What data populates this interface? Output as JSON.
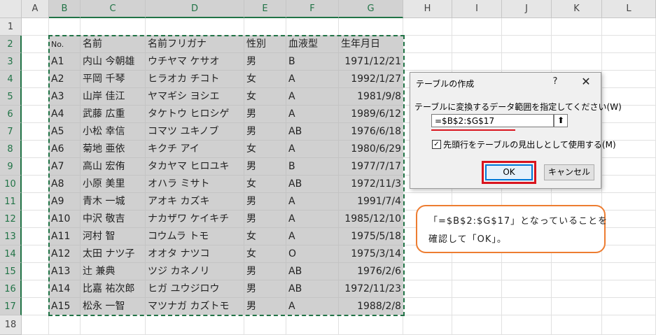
{
  "columns": [
    "A",
    "B",
    "C",
    "D",
    "E",
    "F",
    "G",
    "H",
    "I",
    "J",
    "K",
    "L"
  ],
  "rows": [
    "1",
    "2",
    "3",
    "4",
    "5",
    "6",
    "7",
    "8",
    "9",
    "10",
    "11",
    "12",
    "13",
    "14",
    "15",
    "16",
    "17",
    "18"
  ],
  "table": {
    "headers": [
      "No.",
      "名前",
      "名前フリガナ",
      "性別",
      "血液型",
      "生年月日"
    ],
    "data": [
      [
        "A1",
        "内山 今朝雄",
        "ウチヤマ ケサオ",
        "男",
        "B",
        "1971/12/21"
      ],
      [
        "A2",
        "平岡 千琴",
        "ヒラオカ チコト",
        "女",
        "A",
        "1992/1/27"
      ],
      [
        "A3",
        "山岸 佳江",
        "ヤマギシ ヨシエ",
        "女",
        "A",
        "1981/9/8"
      ],
      [
        "A4",
        "武藤 広重",
        "タケトウ ヒロシゲ",
        "男",
        "A",
        "1989/6/12"
      ],
      [
        "A5",
        "小松 幸信",
        "コマツ ユキノブ",
        "男",
        "AB",
        "1976/6/18"
      ],
      [
        "A6",
        "菊地 亜依",
        "キクチ アイ",
        "女",
        "A",
        "1980/6/29"
      ],
      [
        "A7",
        "高山 宏侑",
        "タカヤマ ヒロユキ",
        "男",
        "B",
        "1977/7/17"
      ],
      [
        "A8",
        "小原 美里",
        "オハラ ミサト",
        "女",
        "AB",
        "1972/11/3"
      ],
      [
        "A9",
        "青木 一城",
        "アオキ カズキ",
        "男",
        "A",
        "1991/7/4"
      ],
      [
        "A10",
        "中沢 敬吉",
        "ナカザワ ケイキチ",
        "男",
        "A",
        "1985/12/10"
      ],
      [
        "A11",
        "河村 智",
        "コウムラ トモ",
        "女",
        "A",
        "1975/5/18"
      ],
      [
        "A12",
        "太田 ナツ子",
        "オオタ ナツコ",
        "女",
        "O",
        "1975/3/14"
      ],
      [
        "A13",
        "辻 兼典",
        "ツジ カネノリ",
        "男",
        "AB",
        "1976/2/6"
      ],
      [
        "A14",
        "比嘉 祐次郎",
        "ヒガ ユウジロウ",
        "男",
        "AB",
        "1972/11/23"
      ],
      [
        "A15",
        "松永 一智",
        "マツナガ カズトモ",
        "男",
        "A",
        "1988/2/8"
      ]
    ]
  },
  "dialog": {
    "title": "テーブルの作成",
    "help": "?",
    "close": "✕",
    "range_label": "テーブルに変換するデータ範囲を指定してください(W)",
    "range_value": "=$B$2:$G$17",
    "ref_icon": "⬆",
    "checkbox_checked": "✓",
    "checkbox_label": "先頭行をテーブルの見出しとして使用する(M)",
    "ok": "OK",
    "cancel": "キャンセル"
  },
  "callout": {
    "line1": "「=$B$2:$G$17」となっていることを",
    "line2": "確認して「OK」。"
  },
  "colors": {
    "excel_green": "#217346",
    "selection_gray": "#d0d0d0",
    "highlight_red": "#d9141e",
    "callout_orange": "#ed7d31"
  }
}
